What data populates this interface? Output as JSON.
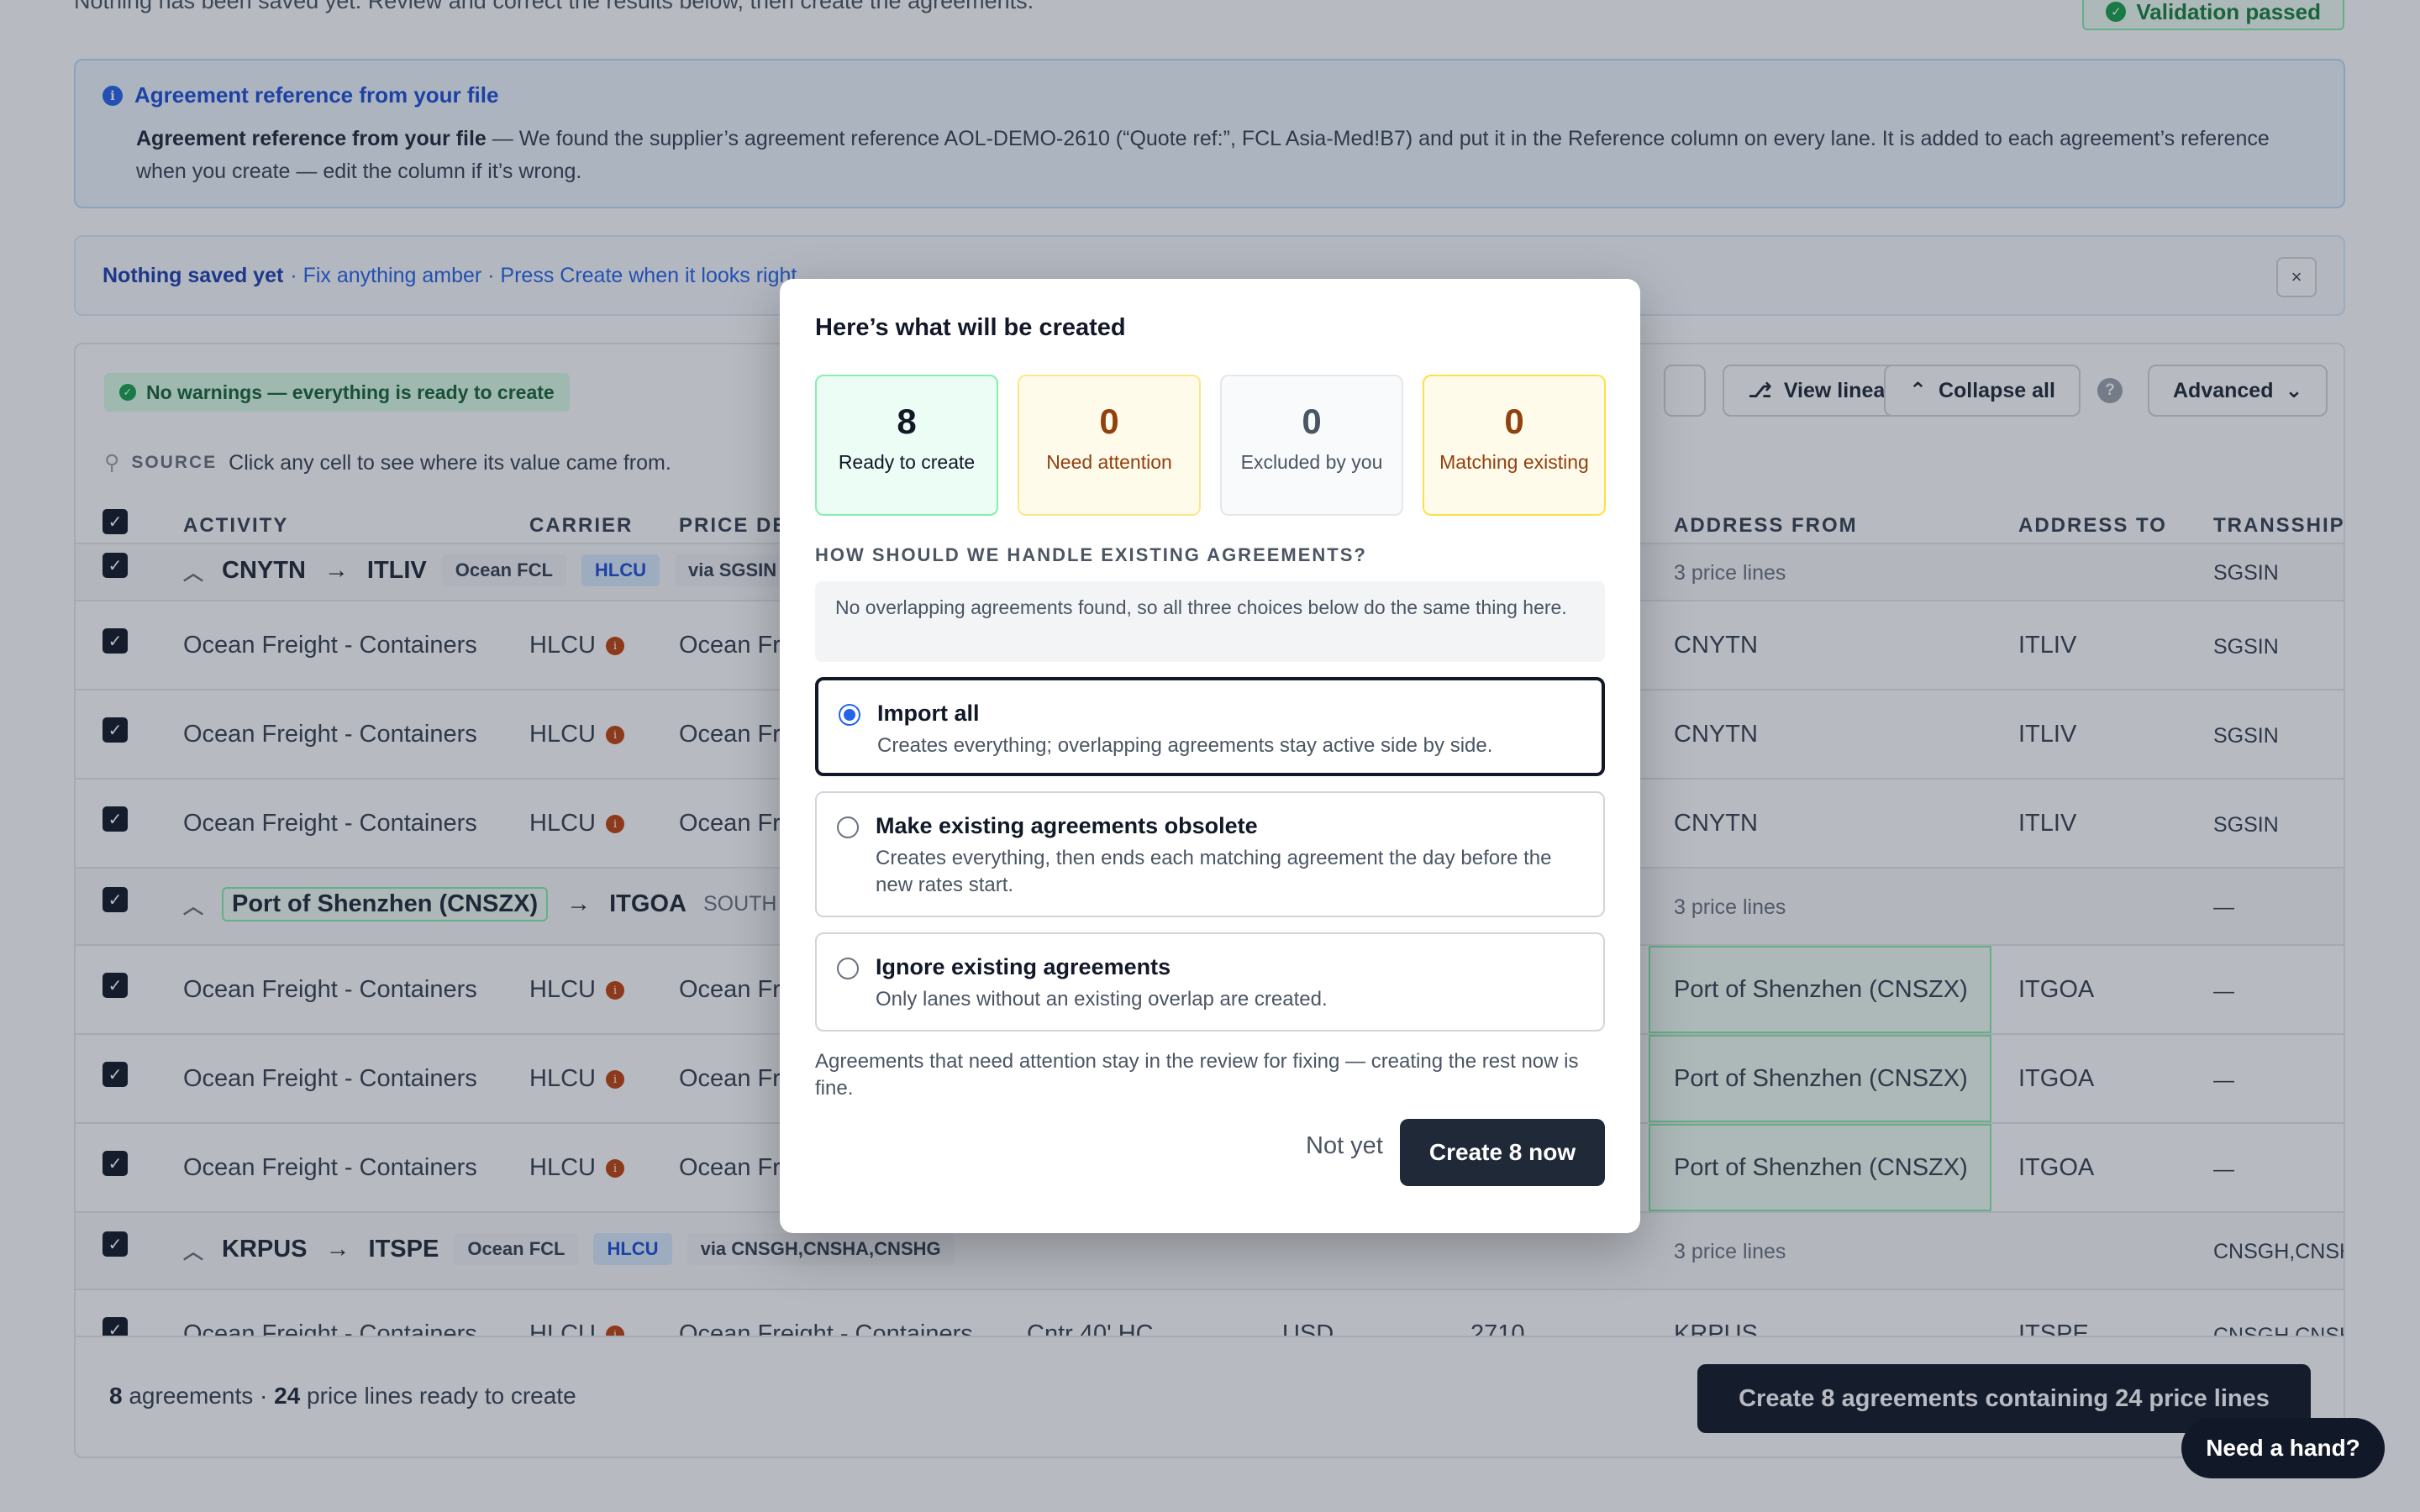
{
  "header": {
    "intro_text": "Nothing has been saved yet. Review and correct the results below, then create the agreements.",
    "validation_badge": "Validation passed"
  },
  "info": {
    "title": "Agreement reference from your file",
    "body_bold": "Agreement reference from your file",
    "body_text": " — We found the supplier’s agreement reference AOL-DEMO-2610 (“Quote ref:”, FCL Asia-Med!B7) and put it in the Reference column on every lane. It is added to each agreement’s reference when you create — edit the column if it’s wrong."
  },
  "saved_bar": {
    "bold": "Nothing saved yet",
    "rest": "· Fix anything amber · Press Create when it looks right",
    "close": "×"
  },
  "toolbar": {
    "warnings": "No warnings — everything is ready to create",
    "view_lineage": "View lineage",
    "collapse_all": "Collapse all",
    "help": "?",
    "advanced": "Advanced"
  },
  "source": {
    "label": "SOURCE",
    "text": "Click any cell to see where its value came from."
  },
  "columns": {
    "activity": "ACTIVITY",
    "carrier": "CARRIER",
    "price_desc": "PRICE DE",
    "address_from": "ADDRESS FROM",
    "address_to": "ADDRESS TO",
    "transship": "TRANSSHIPI"
  },
  "groups": [
    {
      "from": "CNYTN",
      "to": "ITLIV",
      "mode": "Ocean FCL",
      "carrier": "HLCU",
      "via": "via SGSIN",
      "price_lines": "3 price lines",
      "transship": "SGSIN",
      "rows": [
        {
          "activity": "Ocean Freight - Containers",
          "carrier": "HLCU",
          "price": "Ocean Fr",
          "from": "CNYTN",
          "to": "ITLIV",
          "trans": "SGSIN"
        },
        {
          "activity": "Ocean Freight - Containers",
          "carrier": "HLCU",
          "price": "Ocean Fr",
          "from": "CNYTN",
          "to": "ITLIV",
          "trans": "SGSIN"
        },
        {
          "activity": "Ocean Freight - Containers",
          "carrier": "HLCU",
          "price": "Ocean Fr",
          "from": "CNYTN",
          "to": "ITLIV",
          "trans": "SGSIN"
        }
      ]
    },
    {
      "from": "Port of Shenzhen (CNSZX)",
      "to": "ITGOA",
      "region": "SOUTH C",
      "price_lines": "3 price lines",
      "transship": "—",
      "rows": [
        {
          "activity": "Ocean Freight - Containers",
          "carrier": "HLCU",
          "price": "Ocean Fr",
          "from": "Port of Shenzhen (CNSZX)",
          "to": "ITGOA",
          "trans": "—"
        },
        {
          "activity": "Ocean Freight - Containers",
          "carrier": "HLCU",
          "price": "Ocean Fr",
          "from": "Port of Shenzhen (CNSZX)",
          "to": "ITGOA",
          "trans": "—"
        },
        {
          "activity": "Ocean Freight - Containers",
          "carrier": "HLCU",
          "price": "Ocean Fr",
          "from": "Port of Shenzhen (CNSZX)",
          "to": "ITGOA",
          "trans": "—"
        }
      ]
    },
    {
      "from": "KRPUS",
      "to": "ITSPE",
      "mode": "Ocean FCL",
      "carrier": "HLCU",
      "via": "via CNSGH,CNSHA,CNSHG",
      "price_lines": "3 price lines",
      "transship": "CNSGH,CNSH",
      "rows": [
        {
          "activity": "Ocean Freight - Containers",
          "carrier": "HLCU",
          "price": "Ocean Freight - Containers",
          "size": "Cntr 40' HC",
          "currency": "USD",
          "amount": "2710",
          "from": "KRPUS",
          "to": "ITSPE",
          "trans": "CNSGH,CNSH"
        }
      ]
    }
  ],
  "footer": {
    "agreements": "8",
    "agreements_label": "agreements ·",
    "lines": "24",
    "lines_label": "price lines ready to create",
    "create_button": "Create 8 agreements containing 24 price lines"
  },
  "help_button": "Need a hand?",
  "modal": {
    "title": "Here’s what will be created",
    "stats": [
      {
        "num": "8",
        "label": "Ready to create"
      },
      {
        "num": "0",
        "label": "Need attention"
      },
      {
        "num": "0",
        "label": "Excluded by you"
      },
      {
        "num": "0",
        "label": "Matching existing"
      }
    ],
    "section": "HOW SHOULD WE HANDLE EXISTING AGREEMENTS?",
    "note": "No overlapping agreements found, so all three choices below do the same thing here.",
    "options": [
      {
        "title": "Import all",
        "desc": "Creates everything; overlapping agreements stay active side by side.",
        "selected": true
      },
      {
        "title": "Make existing agreements obsolete",
        "desc": "Creates everything, then ends each matching agreement the day before the new rates start.",
        "selected": false
      },
      {
        "title": "Ignore existing agreements",
        "desc": "Only lanes without an existing overlap are created.",
        "selected": false
      }
    ],
    "footnote": "Agreements that need attention stay in the review for fixing — creating the rest now is fine.",
    "not_yet": "Not yet",
    "create_now": "Create 8 now"
  },
  "colors": {
    "primary_dark": "#111827",
    "success": "#16a34a",
    "info": "#2563eb",
    "amber": "#92400e"
  }
}
